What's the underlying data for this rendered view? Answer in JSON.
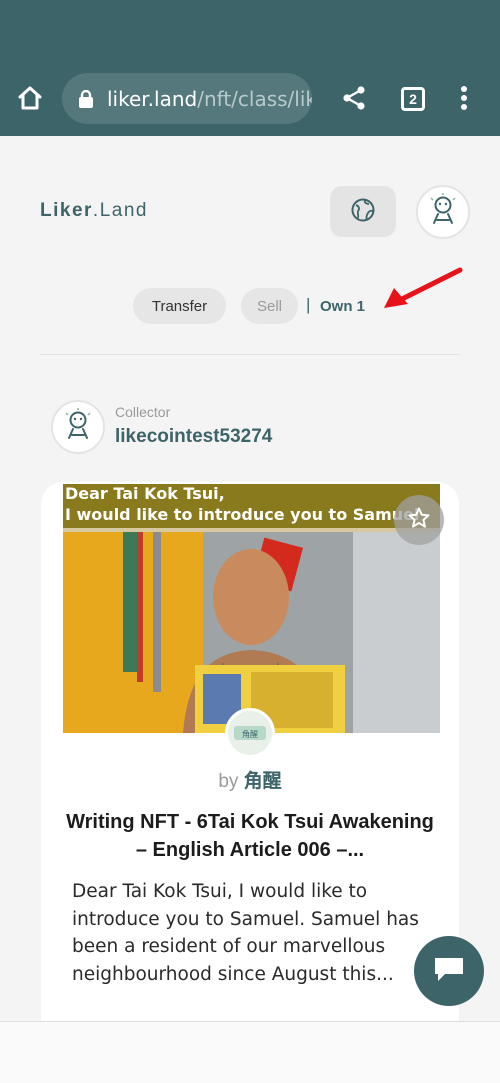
{
  "browser": {
    "url_domain": "liker.land",
    "url_path": "/nft/class/lik",
    "tab_count": "2",
    "icons": [
      "home-icon",
      "lock-icon",
      "share-icon",
      "tab-switcher-icon",
      "more-vert-icon"
    ]
  },
  "header": {
    "logo_main": "Liker",
    "logo_dot": ".",
    "logo_land": "Land",
    "icons": [
      "globe-icon",
      "user-avatar-icon"
    ]
  },
  "actions": {
    "transfer_label": "Transfer",
    "sell_label": "Sell",
    "separator": "|",
    "own_label": "Own 1"
  },
  "annotation": {
    "arrow_color": "#e8121b"
  },
  "collector": {
    "label": "Collector",
    "name": "likecointest53274"
  },
  "nft_card": {
    "image_caption_line1": "Dear Tai Kok Tsui,",
    "image_caption_line2": "I would like to introduce you to Samuel",
    "by_prefix": "by ",
    "author": "角醒",
    "title": "Writing NFT - 6Tai Kok Tsui Awakening – English Article 006 –...",
    "description_lines": [
      "Dear Tai Kok Tsui, I would like to",
      "introduce you to Samuel. Samuel has",
      "been a resident of our marvellous",
      "neighbourhood since August this..."
    ],
    "icons": [
      "star-icon"
    ]
  },
  "fab": {
    "icon": "chat-icon"
  },
  "colors": {
    "brand": "#3d6469",
    "browser_bar": "#3d6469",
    "page_bg": "#f4f4f4",
    "card_bg": "#ffffff",
    "muted": "#9a9a9a"
  }
}
